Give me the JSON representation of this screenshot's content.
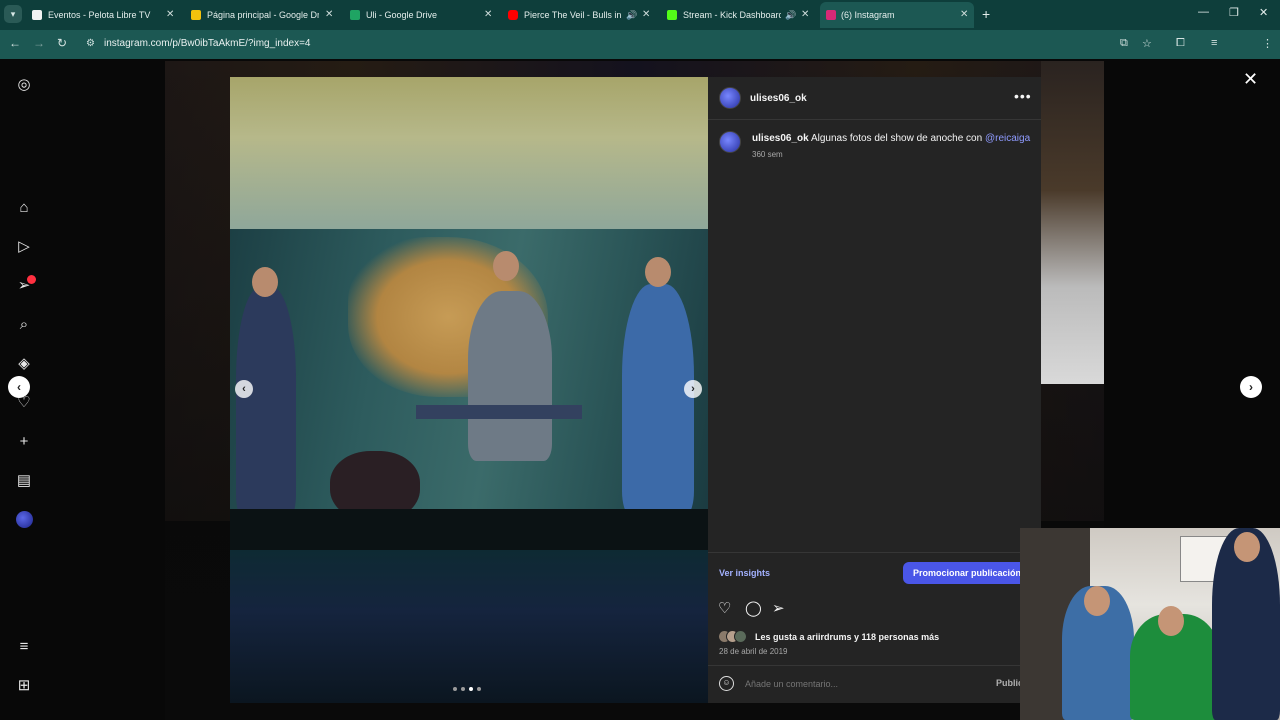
{
  "browser": {
    "tabs": [
      {
        "title": "Eventos - Pelota Libre TV",
        "favicon_color": "#f2f2f2",
        "muted": false,
        "active": false
      },
      {
        "title": "Página principal - Google Drive",
        "favicon_color": "#f4c20d",
        "muted": false,
        "active": false
      },
      {
        "title": "Uli - Google Drive",
        "favicon_color": "#1fa463",
        "muted": false,
        "active": false
      },
      {
        "title": "Pierce The Veil - Bulls in the",
        "favicon_color": "#ff0000",
        "muted": true,
        "active": false
      },
      {
        "title": "Stream - Kick Dashboard",
        "favicon_color": "#53fc18",
        "muted": true,
        "active": false
      },
      {
        "title": "(6) Instagram",
        "favicon_color": "#d62976",
        "muted": false,
        "active": true
      }
    ],
    "url": "instagram.com/p/Bw0ibTaAkmE/?img_index=4",
    "colors": {
      "tabstrip": "#0e3e3b",
      "toolbar": "#1c5853"
    }
  },
  "instagram": {
    "rail_icons": [
      "instagram-logo-icon",
      "home-icon",
      "reels-icon",
      "messages-icon",
      "search-icon",
      "explore-icon",
      "notifications-icon",
      "create-icon",
      "dashboard-icon",
      "profile-avatar",
      "more-menu-icon",
      "threads-icon"
    ],
    "post": {
      "username": "ulises06_ok",
      "caption_user": "ulises06_ok",
      "caption_text": "Algunas fotos del show de anoche con",
      "caption_mention": "@reicaiga",
      "caption_time": "360 sem",
      "insights_label": "Ver insights",
      "promote_label": "Promocionar publicación",
      "likes_text": "Les gusta a ariirdrums y 118 personas más",
      "date": "28 de abril de 2019",
      "comment_placeholder": "Añade un comentario...",
      "post_label": "Publicar",
      "carousel": {
        "total": 4,
        "current": 3
      },
      "accent_color": "#4a56e8"
    }
  }
}
